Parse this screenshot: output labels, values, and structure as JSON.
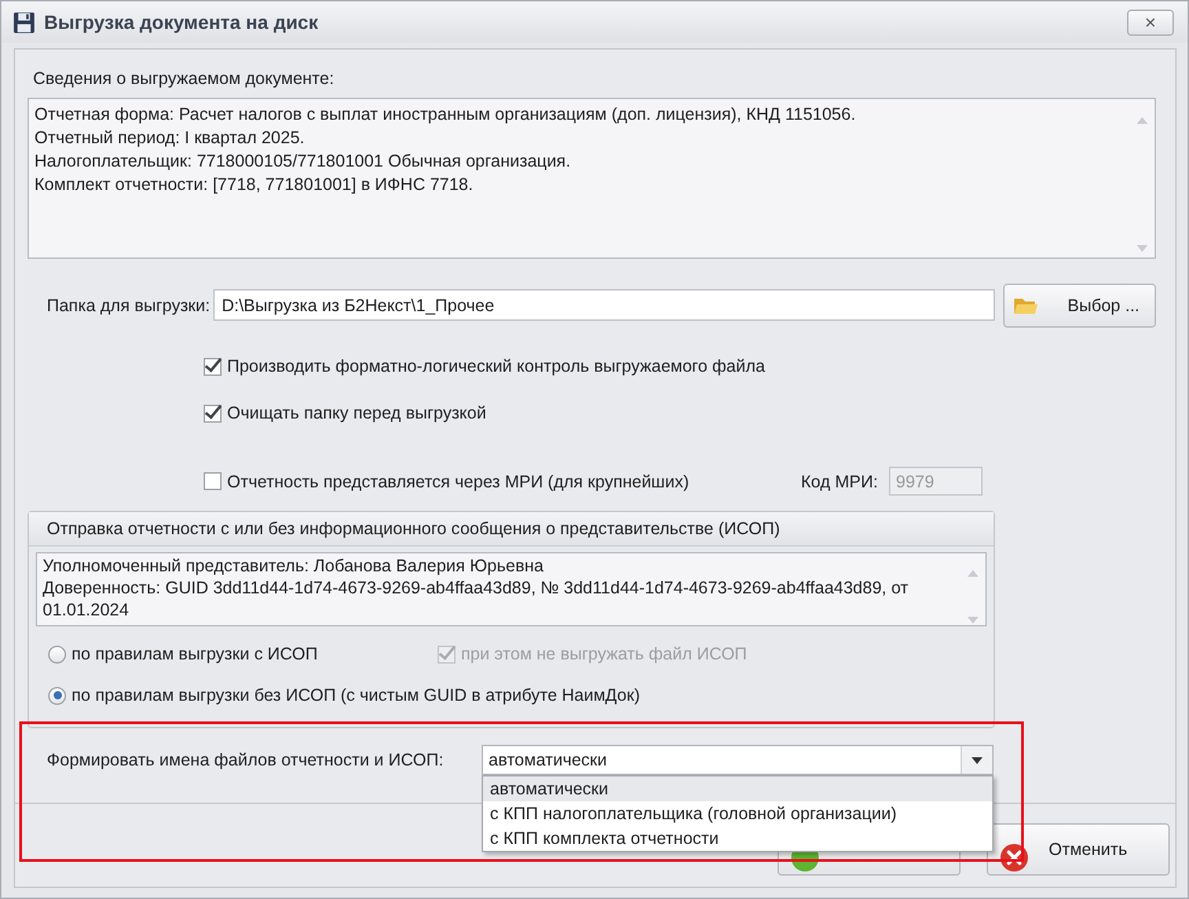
{
  "window": {
    "title": "Выгрузка документа на диск",
    "close": "×"
  },
  "document_info": {
    "label": "Сведения о выгружаемом документе:",
    "lines": [
      "Отчетная форма: Расчет налогов с выплат иностранным организациям (доп. лицензия), КНД 1151056.",
      "Отчетный период: I квартал 2025.",
      "Налогоплательщик: 7718000105/771801001 Обычная организация.",
      "Комплект отчетности: [7718, 771801001] в ИФНС 7718."
    ]
  },
  "folder": {
    "label": "Папка для выгрузки:",
    "value": "D:\\Выгрузка из Б2Некст\\1_Прочее",
    "button": "Выбор ..."
  },
  "options": [
    {
      "label": "Производить форматно-логический контроль выгружаемого файла",
      "checked": true
    },
    {
      "label": "Очищать папку перед выгрузкой",
      "checked": true
    }
  ],
  "mri": {
    "label": "Отчетность представляется через МРИ (для крупнейших)",
    "checked": false,
    "code_label": "Код МРИ:",
    "code_value": "9979"
  },
  "isop": {
    "title": "Отправка отчетности с или без информационного сообщения о представительстве (ИСОП)",
    "info_lines": [
      "Уполномоченный представитель: Лобанова Валерия Юрьевна",
      "Доверенность: GUID 3dd11d44-1d74-4673-9269-ab4ffaa43d89, № 3dd11d44-1d74-4673-9269-ab4ffaa43d89,  от 01.01.2024"
    ],
    "modes": [
      {
        "label": "по правилам выгрузки с ИСОП",
        "selected": false
      },
      {
        "label": "по правилам выгрузки без ИСОП (с чистым GUID в атрибуте НаимДок)",
        "selected": true
      }
    ],
    "skip_file": {
      "label": "при этом не выгружать файл ИСОП",
      "checked": true,
      "disabled": true
    }
  },
  "file_naming": {
    "label": "Формировать имена файлов отчетности и ИСОП:",
    "value": "автоматически",
    "expanded": true,
    "options": [
      {
        "label": "автоматически",
        "selected": true
      },
      {
        "label": "с КПП налогоплательщика (головной организации)",
        "selected": false
      },
      {
        "label": "с КПП комплекта отчетности",
        "selected": false
      }
    ]
  },
  "buttons": [
    {
      "kind": "export"
    },
    {
      "kind": "cancel",
      "label": "Отменить"
    }
  ]
}
